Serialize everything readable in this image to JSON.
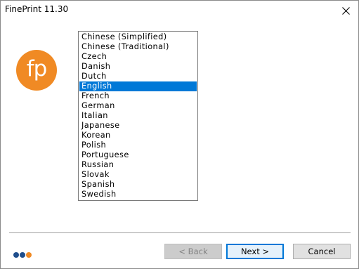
{
  "window": {
    "title": "FinePrint 11.30"
  },
  "logo": {
    "text": "fp",
    "color": "#f08a24"
  },
  "language_list": {
    "selected": "English",
    "items": [
      "Chinese (Simplified)",
      "Chinese (Traditional)",
      "Czech",
      "Danish",
      "Dutch",
      "English",
      "French",
      "German",
      "Italian",
      "Japanese",
      "Korean",
      "Polish",
      "Portuguese",
      "Russian",
      "Slovak",
      "Spanish",
      "Swedish"
    ]
  },
  "progress_dots": {
    "colors": [
      "#1f4e8c",
      "#1f4e8c",
      "#f08a24"
    ]
  },
  "buttons": {
    "back_label": "< Back",
    "next_label": "Next >",
    "cancel_label": "Cancel"
  },
  "colors": {
    "selection": "#0078d7",
    "accent": "#f08a24"
  },
  "icons": {
    "close": "close-icon"
  }
}
